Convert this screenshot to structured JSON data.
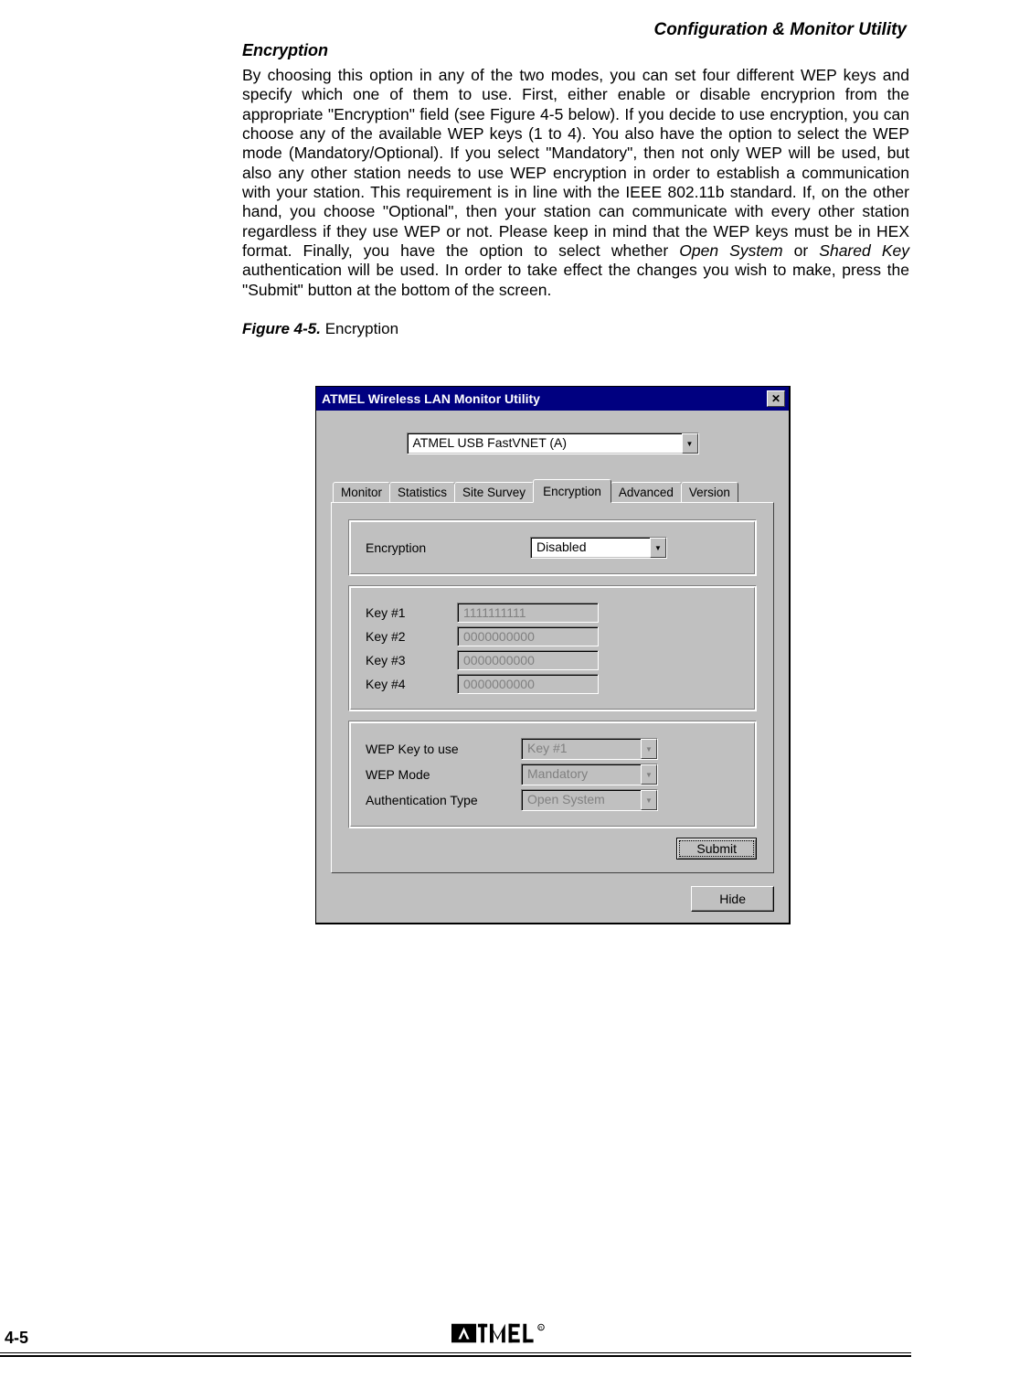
{
  "header": {
    "title": "Configuration & Monitor Utility"
  },
  "section": {
    "heading": "Encryption",
    "body_pre": "By choosing this option in any of the two modes, you can set four different WEP keys and specify which one of them to use. First, either enable or disable encryprion from the appropriate \"Encryption\" field (see Figure 4-5 below). If you decide to use encryption, you can choose any of the available WEP keys (1 to 4). You also have the option to select the WEP mode (Mandatory/Optional). If you select \"Mandatory\", then not only WEP will be used, but also any other station needs to use WEP encryption in order to establish a communication with your station. This requirement is in line with the IEEE 802.11b standard. If, on the other hand, you choose \"Optional\", then your station can communicate with every other station regardless if they use WEP or not. Please keep in mind that the WEP keys must be in HEX format. Finally, you have the option to select whether ",
    "open_system": "Open System",
    "mid": " or ",
    "shared_key": "Shared Key",
    "body_post": " authentication will be used. In order to take effect the changes you wish to make, press the \"Submit\" button at the bottom of the screen."
  },
  "figure": {
    "label": "Figure 4-5.",
    "caption": "Encryption"
  },
  "dialog": {
    "title": "ATMEL Wireless LAN Monitor Utility",
    "adapter": "ATMEL USB FastVNET (A)",
    "tabs": {
      "monitor": "Monitor",
      "statistics": "Statistics",
      "site_survey": "Site Survey",
      "encryption": "Encryption",
      "advanced": "Advanced",
      "version": "Version"
    },
    "encryption": {
      "label": "Encryption",
      "value": "Disabled"
    },
    "keys": {
      "k1_label": "Key #1",
      "k1_value": "1111111111",
      "k2_label": "Key #2",
      "k2_value": "0000000000",
      "k3_label": "Key #3",
      "k3_value": "0000000000",
      "k4_label": "Key #4",
      "k4_value": "0000000000"
    },
    "settings": {
      "wep_key_label": "WEP Key to use",
      "wep_key_value": "Key #1",
      "wep_mode_label": "WEP Mode",
      "wep_mode_value": "Mandatory",
      "auth_label": "Authentication Type",
      "auth_value": "Open System"
    },
    "buttons": {
      "submit": "Submit",
      "hide": "Hide"
    }
  },
  "footer": {
    "page": "4-5"
  }
}
